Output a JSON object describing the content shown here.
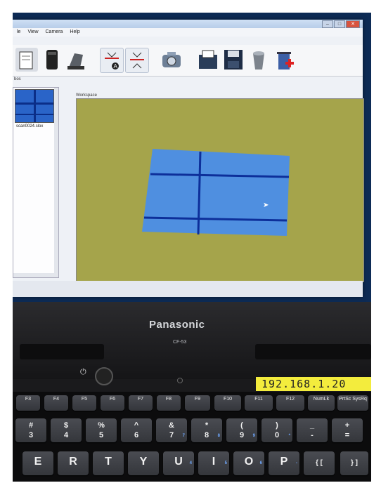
{
  "app": {
    "menu": [
      "le",
      "View",
      "Camera",
      "Help"
    ],
    "workspace_label": "Workspace",
    "panel_label": "bos",
    "thumbnail_caption": "scan0024.slox"
  },
  "laptop": {
    "brand": "Panasonic",
    "model": "CF-53",
    "ip_label": "192.168.1.20"
  },
  "keyboard": {
    "function_keys": [
      "F3",
      "F4",
      "F5",
      "F6",
      "F7",
      "F8",
      "F9",
      "F10",
      "F11",
      "F12",
      "NumLk",
      "PrtSc SysRq"
    ],
    "number_keys": [
      {
        "main": "#\n3"
      },
      {
        "main": "$\n4"
      },
      {
        "main": "%\n5"
      },
      {
        "main": "^\n6"
      },
      {
        "main": "&\n7",
        "sub": "7"
      },
      {
        "main": "*\n8",
        "sub": "8"
      },
      {
        "main": "(\n9",
        "sub": "9"
      },
      {
        "main": ")\n0",
        "sub": "*"
      },
      {
        "main": "_\n-"
      },
      {
        "main": "+\n="
      }
    ],
    "letter_keys": [
      {
        "main": "E"
      },
      {
        "main": "R"
      },
      {
        "main": "T"
      },
      {
        "main": "Y"
      },
      {
        "main": "U",
        "sub": "4"
      },
      {
        "main": "I",
        "sub": "5"
      },
      {
        "main": "O",
        "sub": "6"
      },
      {
        "main": "P",
        "sub": "-"
      },
      {
        "main": "{ ["
      },
      {
        "main": "} ]"
      }
    ]
  },
  "colors": {
    "workspace_bg": "#a5a44b",
    "scan_blue": "#4f8fe0",
    "ip_label_bg": "#f3ec3d"
  }
}
